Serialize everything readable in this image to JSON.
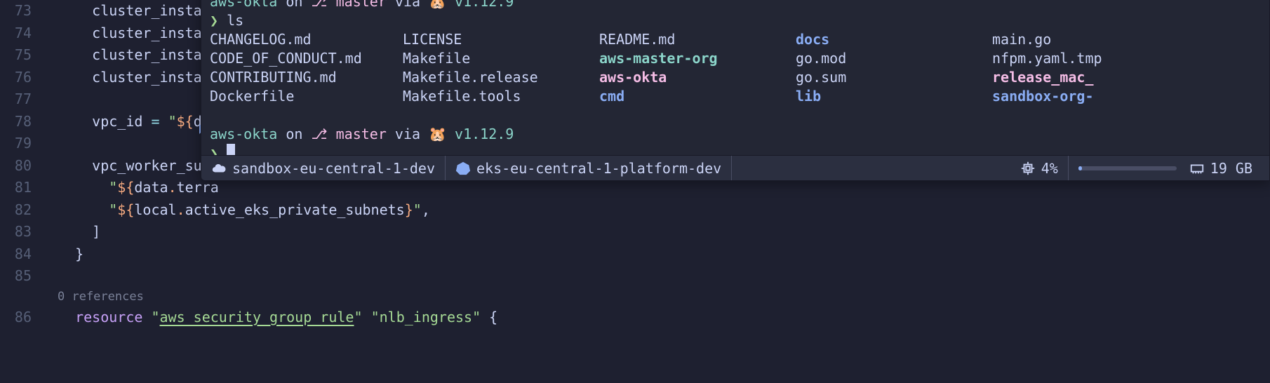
{
  "editor": {
    "lines": [
      {
        "num": 73,
        "text": "cluster_instanc"
      },
      {
        "num": 74,
        "text": "cluster_instanc"
      },
      {
        "num": 75,
        "text": "cluster_instanc"
      },
      {
        "num": 76,
        "text": "cluster_instanc"
      },
      {
        "num": 77,
        "text": ""
      },
      {
        "num": 78,
        "text_pre": "vpc_id = \"${dat",
        "indent": "    "
      },
      {
        "num": 79,
        "text": ""
      },
      {
        "num": 80,
        "text": "vpc_worker_subn",
        "indent": "    "
      },
      {
        "num": 81,
        "indent": "      ",
        "interp": "${data.terra"
      },
      {
        "num": 82,
        "indent": "      ",
        "interp_full": "${local.active_eks_private_subnets}",
        "tail": "\","
      },
      {
        "num": 83,
        "indent": "    ",
        "text": "]"
      },
      {
        "num": 84,
        "indent": "  ",
        "text": "}"
      },
      {
        "num": 85,
        "text": ""
      }
    ],
    "references_label": "0 references",
    "resource_line": {
      "num": 86,
      "keyword": "resource",
      "arg1": "aws_security_group_rule",
      "arg2": "nlb_ingress"
    }
  },
  "terminal": {
    "prompt_top": {
      "project": "aws-okta",
      "on": "on",
      "branch": "master",
      "via": "via",
      "emoji": "🐹",
      "version": "v1.12.9"
    },
    "ls_cmd": "ls",
    "ls_cols": [
      [
        "CHANGELOG.md",
        "CODE_OF_CONDUCT.md",
        "CONTRIBUTING.md",
        "Dockerfile"
      ],
      [
        "LICENSE",
        "Makefile",
        "Makefile.release",
        "Makefile.tools"
      ],
      [
        "README.md",
        "aws-master-org",
        "aws-okta",
        "cmd"
      ],
      [
        "docs",
        "go.mod",
        "go.sum",
        "lib"
      ],
      [
        "main.go",
        "nfpm.yaml.tmp",
        "release_mac_",
        "sandbox-org-"
      ]
    ],
    "ls_styles": [
      [
        "",
        "",
        "",
        ""
      ],
      [
        "",
        "",
        "",
        ""
      ],
      [
        "",
        "t-cyanb",
        "t-mag-exec",
        "t-blue"
      ],
      [
        "t-blue",
        "",
        "",
        "t-blue"
      ],
      [
        "",
        "",
        "t-mag-exec",
        "t-blue"
      ]
    ],
    "prompt_bottom": {
      "project": "aws-okta",
      "on": "on",
      "branch": "master",
      "via": "via",
      "emoji": "🐹",
      "version": "v1.12.9"
    }
  },
  "status": {
    "cloud_context": "sandbox-eu-central-1-dev",
    "k8s_context": "eks-eu-central-1-platform-dev",
    "cpu_pct": "4%",
    "ram": "19 GB"
  },
  "icons": {
    "cloud": "☁️",
    "k8s": "⎈",
    "cpu": "cpu",
    "ram": "ram"
  }
}
